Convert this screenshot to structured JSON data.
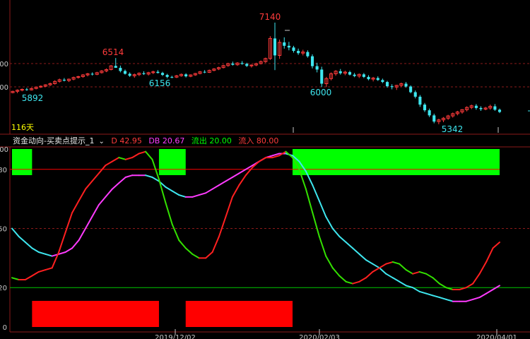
{
  "colors": {
    "background": "#000000",
    "up_candle": "#ff3b3b",
    "down_candle": "#3ee6ef",
    "grid_dash": "#8b1a1a",
    "axis": "#8b1a1a",
    "d_line": "#ff2020",
    "db_line": "#ff3bff",
    "cyan_line": "#3ee6ef",
    "green_line": "#33e000",
    "out_level_line": "#00c800",
    "in_level_line": "#ff0000",
    "inflow_bar": "#ff0000",
    "outflow_bar": "#00ff00",
    "tick_text": "#c8c8c8",
    "days_text": "#ffff00"
  },
  "price_panel": {
    "y_tick_labels": [
      "00",
      "00"
    ],
    "annotations": [
      {
        "text": "7140",
        "color": "red"
      },
      {
        "text": "6514",
        "color": "red"
      },
      {
        "text": "5892",
        "color": "cyan"
      },
      {
        "text": "6156",
        "color": "cyan"
      },
      {
        "text": "6000",
        "color": "cyan"
      },
      {
        "text": "5342",
        "color": "cyan"
      }
    ],
    "days_label": "116天"
  },
  "indicator": {
    "name": "资金动向-买卖点提示_1",
    "caret": "⌄",
    "d_label": "D 42.95",
    "db_label": "DB 20.67",
    "out_label": "流出 20.00",
    "in_label": "流入 80.00"
  },
  "signal_panel": {
    "y_tick_label": "00"
  },
  "oscillator_panel": {
    "y_tick_labels": [
      "80",
      "50",
      "20",
      "0"
    ]
  },
  "x_axis": {
    "tick_labels": [
      "2019/12/02",
      "2020/02/03",
      "2020/04/01"
    ]
  },
  "chart_data": [
    {
      "type": "candlestick",
      "annotated_extremes": [
        {
          "label": "5892",
          "kind": "low"
        },
        {
          "label": "6514",
          "kind": "high"
        },
        {
          "label": "6156",
          "kind": "low"
        },
        {
          "label": "7140",
          "kind": "high"
        },
        {
          "label": "6000",
          "kind": "low"
        },
        {
          "label": "5342",
          "kind": "low"
        }
      ],
      "n_bars": 116,
      "ohlc": [
        [
          5902,
          5935,
          5890,
          5925
        ],
        [
          5925,
          5960,
          5892,
          5945
        ],
        [
          5945,
          5975,
          5925,
          5960
        ],
        [
          5960,
          5985,
          5935,
          5950
        ],
        [
          5950,
          5990,
          5940,
          5975
        ],
        [
          5975,
          6010,
          5960,
          6000
        ],
        [
          6000,
          6030,
          5985,
          6015
        ],
        [
          6015,
          6050,
          6000,
          6040
        ],
        [
          6040,
          6080,
          6020,
          6060
        ],
        [
          6060,
          6120,
          6045,
          6100
        ],
        [
          6100,
          6150,
          6080,
          6130
        ],
        [
          6130,
          6160,
          6100,
          6115
        ],
        [
          6115,
          6150,
          6090,
          6140
        ],
        [
          6140,
          6185,
          6120,
          6170
        ],
        [
          6170,
          6200,
          6150,
          6185
        ],
        [
          6185,
          6230,
          6165,
          6215
        ],
        [
          6215,
          6250,
          6190,
          6235
        ],
        [
          6235,
          6260,
          6205,
          6225
        ],
        [
          6225,
          6270,
          6210,
          6255
        ],
        [
          6255,
          6300,
          6240,
          6285
        ],
        [
          6285,
          6330,
          6265,
          6310
        ],
        [
          6310,
          6390,
          6295,
          6375
        ],
        [
          6375,
          6514,
          6350,
          6340
        ],
        [
          6340,
          6380,
          6260,
          6285
        ],
        [
          6285,
          6310,
          6220,
          6235
        ],
        [
          6235,
          6260,
          6180,
          6200
        ],
        [
          6200,
          6240,
          6165,
          6220
        ],
        [
          6220,
          6260,
          6195,
          6245
        ],
        [
          6245,
          6280,
          6215,
          6230
        ],
        [
          6230,
          6270,
          6205,
          6255
        ],
        [
          6255,
          6290,
          6230,
          6270
        ],
        [
          6270,
          6300,
          6240,
          6250
        ],
        [
          6250,
          6270,
          6195,
          6215
        ],
        [
          6215,
          6235,
          6156,
          6180
        ],
        [
          6180,
          6200,
          6156,
          6175
        ],
        [
          6175,
          6215,
          6160,
          6200
        ],
        [
          6200,
          6240,
          6185,
          6225
        ],
        [
          6225,
          6245,
          6170,
          6190
        ],
        [
          6190,
          6225,
          6175,
          6215
        ],
        [
          6215,
          6250,
          6200,
          6240
        ],
        [
          6240,
          6285,
          6225,
          6270
        ],
        [
          6270,
          6300,
          6245,
          6260
        ],
        [
          6260,
          6310,
          6250,
          6295
        ],
        [
          6295,
          6335,
          6280,
          6320
        ],
        [
          6320,
          6360,
          6300,
          6345
        ],
        [
          6345,
          6395,
          6330,
          6380
        ],
        [
          6380,
          6430,
          6360,
          6415
        ],
        [
          6415,
          6450,
          6380,
          6395
        ],
        [
          6395,
          6440,
          6375,
          6425
        ],
        [
          6425,
          6460,
          6395,
          6410
        ],
        [
          6410,
          6430,
          6355,
          6375
        ],
        [
          6375,
          6400,
          6345,
          6390
        ],
        [
          6390,
          6430,
          6370,
          6415
        ],
        [
          6415,
          6470,
          6400,
          6450
        ],
        [
          6450,
          6520,
          6430,
          6505
        ],
        [
          6505,
          6900,
          6480,
          6860
        ],
        [
          6860,
          7140,
          6300,
          6560
        ],
        [
          6560,
          6840,
          6500,
          6790
        ],
        [
          6790,
          6880,
          6680,
          6730
        ],
        [
          6730,
          6800,
          6650,
          6700
        ],
        [
          6700,
          6730,
          6610,
          6640
        ],
        [
          6640,
          6680,
          6570,
          6600
        ],
        [
          6600,
          6660,
          6560,
          6620
        ],
        [
          6620,
          6650,
          6520,
          6545
        ],
        [
          6545,
          6580,
          6330,
          6370
        ],
        [
          6370,
          6430,
          6260,
          6310
        ],
        [
          6310,
          6360,
          6000,
          6060
        ],
        [
          6060,
          6180,
          6000,
          6150
        ],
        [
          6150,
          6260,
          6120,
          6235
        ],
        [
          6235,
          6300,
          6200,
          6280
        ],
        [
          6280,
          6320,
          6220,
          6245
        ],
        [
          6245,
          6290,
          6210,
          6265
        ],
        [
          6265,
          6290,
          6205,
          6220
        ],
        [
          6220,
          6250,
          6175,
          6195
        ],
        [
          6195,
          6240,
          6160,
          6225
        ],
        [
          6225,
          6250,
          6160,
          6180
        ],
        [
          6180,
          6210,
          6120,
          6140
        ],
        [
          6140,
          6180,
          6100,
          6160
        ],
        [
          6160,
          6190,
          6110,
          6125
        ],
        [
          6125,
          6150,
          6070,
          6090
        ],
        [
          6090,
          6110,
          5990,
          6015
        ],
        [
          6015,
          6050,
          5960,
          6000
        ],
        [
          6000,
          6040,
          5950,
          6030
        ],
        [
          6030,
          6080,
          6000,
          6060
        ],
        [
          6060,
          6090,
          5990,
          6010
        ],
        [
          6010,
          6030,
          5890,
          5910
        ],
        [
          5910,
          5940,
          5800,
          5830
        ],
        [
          5830,
          5860,
          5650,
          5690
        ],
        [
          5690,
          5720,
          5560,
          5590
        ],
        [
          5590,
          5620,
          5470,
          5500
        ],
        [
          5500,
          5530,
          5360,
          5390
        ],
        [
          5390,
          5440,
          5342,
          5420
        ],
        [
          5420,
          5470,
          5380,
          5450
        ],
        [
          5450,
          5510,
          5420,
          5490
        ],
        [
          5490,
          5550,
          5460,
          5530
        ],
        [
          5530,
          5580,
          5500,
          5560
        ],
        [
          5560,
          5610,
          5530,
          5600
        ],
        [
          5600,
          5660,
          5570,
          5640
        ],
        [
          5640,
          5690,
          5610,
          5670
        ],
        [
          5670,
          5700,
          5600,
          5630
        ],
        [
          5630,
          5660,
          5580,
          5610
        ],
        [
          5610,
          5650,
          5590,
          5630
        ],
        [
          5630,
          5690,
          5600,
          5660
        ],
        [
          5660,
          5700,
          5580,
          5600
        ],
        [
          5600,
          5620,
          5540,
          5560
        ]
      ]
    },
    {
      "type": "line",
      "title": "资金动向-买卖点提示_1",
      "ylim": [
        0,
        100
      ],
      "reference_lines": [
        {
          "name": "流出",
          "value": 20
        },
        {
          "name": "流入",
          "value": 80
        }
      ],
      "series": [
        {
          "name": "D",
          "last_value": 42.95,
          "values": [
            25,
            24,
            24,
            26,
            28,
            29,
            30,
            38,
            48,
            58,
            64,
            70,
            74,
            78,
            82,
            84,
            86,
            85,
            86,
            88,
            89,
            85,
            75,
            63,
            52,
            44,
            40,
            37,
            35,
            35,
            38,
            46,
            56,
            66,
            72,
            77,
            81,
            84,
            86,
            86,
            87,
            89,
            86,
            80,
            70,
            58,
            46,
            36,
            30,
            26,
            23,
            22,
            23,
            25,
            28,
            30,
            32,
            33,
            32,
            29,
            27,
            28,
            27,
            25,
            22,
            20,
            19,
            19,
            20,
            22,
            27,
            33,
            40,
            43
          ]
        },
        {
          "name": "DB",
          "last_value": 20.67,
          "values": [
            50,
            46,
            43,
            40,
            38,
            37,
            36,
            37,
            38,
            40,
            44,
            50,
            56,
            62,
            66,
            70,
            73,
            76,
            77,
            77,
            77,
            76,
            74,
            71,
            69,
            67,
            66,
            66,
            67,
            68,
            70,
            72,
            74,
            76,
            78,
            80,
            82,
            84,
            86,
            87,
            88,
            88,
            87,
            84,
            79,
            72,
            64,
            56,
            50,
            46,
            43,
            40,
            37,
            34,
            32,
            30,
            27,
            25,
            23,
            21,
            20,
            18,
            17,
            16,
            15,
            14,
            13,
            13,
            13,
            14,
            15,
            17,
            19,
            21
          ]
        }
      ],
      "signals": [
        {
          "name": "流入",
          "segments": [
            {
              "start_index": 3,
              "end_index": 22
            },
            {
              "start_index": 26,
              "end_index": 42
            }
          ]
        },
        {
          "name": "流出",
          "segments": [
            {
              "start_index": 0,
              "end_index": 3
            },
            {
              "start_index": 22,
              "end_index": 26
            },
            {
              "start_index": 42,
              "end_index": 73
            }
          ]
        }
      ]
    }
  ]
}
